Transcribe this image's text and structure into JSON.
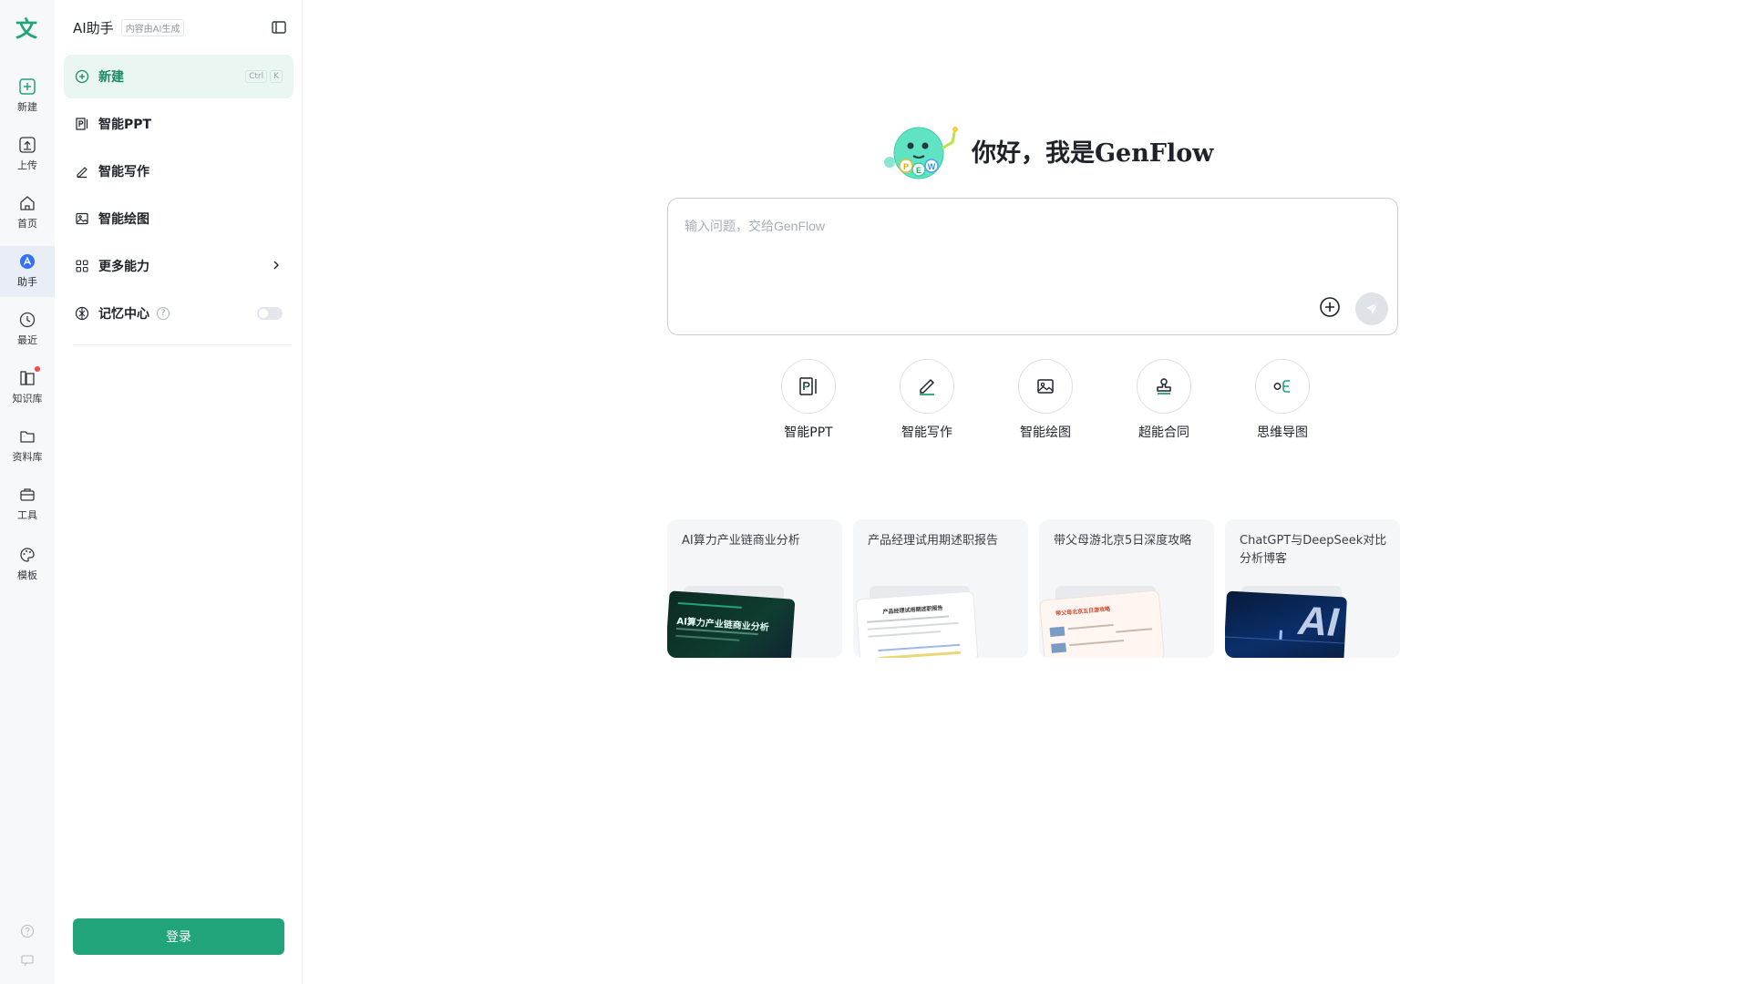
{
  "rail": {
    "logo": "文",
    "items": [
      {
        "label": "新建",
        "icon": "plus-square-icon"
      },
      {
        "label": "上传",
        "icon": "upload-icon"
      },
      {
        "label": "首页",
        "icon": "home-icon"
      },
      {
        "label": "助手",
        "icon": "assistant-icon",
        "active": true
      },
      {
        "label": "最近",
        "icon": "clock-icon"
      },
      {
        "label": "知识库",
        "icon": "knowledge-base-icon"
      },
      {
        "label": "资料库",
        "icon": "folder-icon"
      },
      {
        "label": "工具",
        "icon": "toolbox-icon"
      },
      {
        "label": "模板",
        "icon": "palette-icon"
      }
    ]
  },
  "panel": {
    "title": "AI助手",
    "badge": "内容由AI生成",
    "menu": [
      {
        "label": "新建",
        "shortcut": [
          "Ctrl",
          "K"
        ]
      },
      {
        "label": "智能PPT"
      },
      {
        "label": "智能写作"
      },
      {
        "label": "智能绘图"
      },
      {
        "label": "更多能力"
      },
      {
        "label": "记忆中心",
        "help": "?"
      }
    ],
    "login_label": "登录"
  },
  "main": {
    "greeting": "你好，我是GenFlow",
    "mascot_text": "PEW",
    "composer_placeholder": "输入问题，交给GenFlow",
    "quick_actions": [
      {
        "label": "智能PPT",
        "icon": "ppt-icon"
      },
      {
        "label": "智能写作",
        "icon": "pen-icon"
      },
      {
        "label": "智能绘图",
        "icon": "image-icon"
      },
      {
        "label": "超能合同",
        "icon": "stamp-icon"
      },
      {
        "label": "思维导图",
        "icon": "mindmap-icon"
      }
    ],
    "cards": [
      {
        "title": "AI算力产业链商业分析",
        "thumb_text": "AI算力产业链商业分析"
      },
      {
        "title": "产品经理试用期述职报告",
        "thumb_text": "产品经理试用期述职报告"
      },
      {
        "title": "带父母游北京5日深度攻略",
        "thumb_text": "带父母北京五日游攻略"
      },
      {
        "title": "ChatGPT与DeepSeek对比分析博客",
        "thumb_text": "AI"
      }
    ]
  },
  "colors": {
    "accent": "#21a47a",
    "accent_light": "#eaf6f1",
    "rail_bg": "#f7f8fa",
    "active_blue": "#3370ff"
  }
}
